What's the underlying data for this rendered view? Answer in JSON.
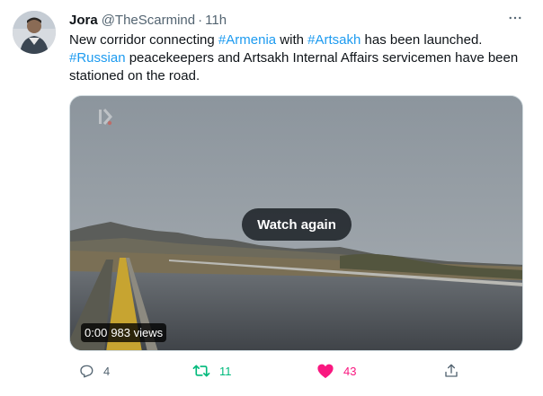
{
  "tweet": {
    "author_name": "Jora",
    "handle": "@TheScarmind",
    "separator": "·",
    "time": "11h",
    "text": {
      "w1": "New corridor connecting ",
      "h1": "#Armenia",
      "w2": " with ",
      "h2": "#Artsakh",
      "w3": " has been launched.",
      "h3": "#Russian",
      "w4": " peacekeepers and Artsakh Internal Affairs servicemen have been stationed on the road."
    }
  },
  "icons": {
    "more": "more-horizontal-icon",
    "reply": "reply-icon",
    "retweet": "retweet-icon",
    "like": "heart-filled-icon",
    "share": "share-icon",
    "watermark": "channel-logo-icon"
  },
  "video": {
    "watch_again_label": "Watch again",
    "timestamp": "0:00",
    "views": "983 views"
  },
  "metrics": {
    "replies": "4",
    "retweets": "11",
    "likes": "43"
  },
  "colors": {
    "hashtag": "#1d9bf0",
    "retweet_active": "#00ba7c",
    "like_active": "#f91880",
    "secondary_text": "#536471"
  }
}
